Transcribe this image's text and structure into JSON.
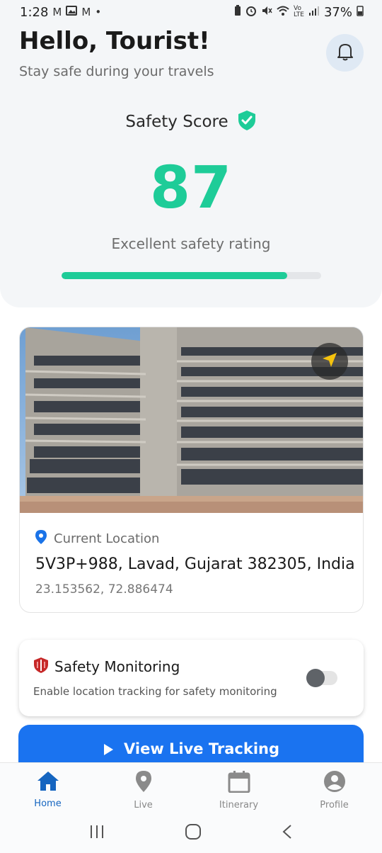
{
  "status_bar": {
    "time": "1:28",
    "battery": "37%",
    "left_icons": [
      "gmail-icon",
      "photo-icon",
      "gmail-icon",
      "dot-icon"
    ],
    "right_icons": [
      "battery-saver-icon",
      "alarm-icon",
      "mute-icon",
      "wifi-icon",
      "volte-icon",
      "signal-icon",
      "battery-icon"
    ]
  },
  "header": {
    "greeting": "Hello, Tourist!",
    "subtitle": "Stay safe during your travels",
    "bell_icon": "bell-icon"
  },
  "safety_score": {
    "title": "Safety Score",
    "value": "87",
    "caption": "Excellent safety rating",
    "progress_fraction": 0.87,
    "color": "#1ecc98"
  },
  "location": {
    "label": "Current Location",
    "address": "5V3P+988, Lavad, Gujarat 382305, India",
    "coordinates": "23.153562, 72.886474",
    "pin_icon": "location-pin-icon",
    "nav_icon": "navigation-arrow-icon"
  },
  "monitoring": {
    "title": "Safety Monitoring",
    "description": "Enable location tracking for safety monitoring",
    "enabled": false,
    "shield_icon": "shield-icon"
  },
  "live_tracking": {
    "label": "View Live Tracking",
    "color": "#1a73f0"
  },
  "bottom_nav": {
    "items": [
      {
        "label": "Home",
        "icon": "home-icon",
        "active": true
      },
      {
        "label": "Live",
        "icon": "location-pin-icon",
        "active": false
      },
      {
        "label": "Itinerary",
        "icon": "calendar-icon",
        "active": false
      },
      {
        "label": "Profile",
        "icon": "account-icon",
        "active": false
      }
    ]
  },
  "system_nav": [
    "recents-icon",
    "home-circle-icon",
    "back-icon"
  ]
}
